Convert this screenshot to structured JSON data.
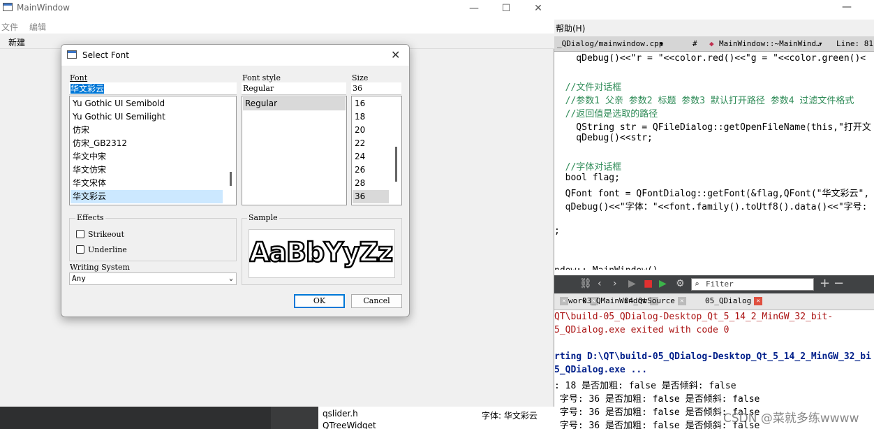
{
  "ide": {
    "minimize": "—",
    "menu_help": "帮助(H)",
    "tabbar": {
      "file": "_QDialog/mainwindow.cpp",
      "hash": "#",
      "symbol": "MainWindow::~MainWind…",
      "line": "Line: 81,"
    },
    "editor_lines": [
      {
        "text": "    qDebug()<<\"r = \"<<color.red()<<\"g = \"<<color.green()<",
        "cls": ""
      },
      {
        "text": "",
        "cls": ""
      },
      {
        "text": "  //文件对话框",
        "cls": "c-cmt"
      },
      {
        "text": "  //参数1 父亲 参数2 标题 参数3 默认打开路径 参数4 过滤文件格式",
        "cls": "c-cmt"
      },
      {
        "text": "  //返回值是选取的路径",
        "cls": "c-cmt"
      },
      {
        "text": "    QString str = QFileDialog::getOpenFileName(this,\"打开文",
        "cls": ""
      },
      {
        "text": "    qDebug()<<str;",
        "cls": ""
      },
      {
        "text": "",
        "cls": ""
      },
      {
        "text": "  //字体对话框",
        "cls": "c-cmt"
      },
      {
        "text": "  bool flag;",
        "cls": ""
      },
      {
        "text": "  QFont font = QFontDialog::getFont(&flag,QFont(\"华文彩云\",",
        "cls": ""
      },
      {
        "text": "  qDebug()<<\"字体：\"<<font.family().toUtf8().data()<<\"字号:",
        "cls": ""
      },
      {
        "text": "",
        "cls": ""
      },
      {
        "text": ";",
        "cls": ""
      },
      {
        "text": "",
        "cls": ""
      },
      {
        "text": "",
        "cls": ""
      },
      {
        "text": "ndow::~MainWindow()",
        "cls": ""
      }
    ],
    "filter_placeholder": "Filter",
    "output_tabs": [
      {
        "label": "work",
        "active": false
      },
      {
        "label": "03_QMainWindow",
        "active": false
      },
      {
        "label": "04_QtSource",
        "active": false
      },
      {
        "label": "05_QDialog",
        "active": true
      }
    ],
    "output_lines": [
      {
        "text": "QT\\build-05_QDialog-Desktop_Qt_5_14_2_MinGW_32_bit-",
        "cls": "red"
      },
      {
        "text": "5_QDialog.exe exited with code 0",
        "cls": "red"
      },
      {
        "text": "",
        "cls": ""
      },
      {
        "text": "rting D:\\QT\\build-05_QDialog-Desktop_Qt_5_14_2_MinGW_32_bi",
        "cls": "blue"
      },
      {
        "text": "5_QDialog.exe ...",
        "cls": "blue"
      },
      {
        "text": ": 18 是否加粗: false 是否倾斜: false",
        "cls": ""
      },
      {
        "text": " 字号: 36 是否加粗: false 是否倾斜: false",
        "cls": ""
      },
      {
        "text": " 字号: 36 是否加粗: false 是否倾斜: false",
        "cls": ""
      },
      {
        "text": " 字号: 36 是否加粗: false 是否倾斜: false",
        "cls": ""
      }
    ],
    "bottom_left_file": "qslider.h",
    "bottom_left_file2": "QTreeWidget",
    "bottom_output_prefix": "字体:  华文彩云",
    "watermark": "CSDN @菜就多练wwww"
  },
  "mainwindow": {
    "title": "MainWindow",
    "menu": [
      "文件",
      "编辑"
    ],
    "toolbar_action": "新建",
    "controls": {
      "minimize": "—",
      "maximize": "☐",
      "close": "✕"
    }
  },
  "dialog": {
    "title": "Select Font",
    "close": "✕",
    "font_label": "Font",
    "font_style_label": "Font style",
    "size_label": "Size",
    "font_value": "华文彩云",
    "style_value": "Regular",
    "size_value": "36",
    "fonts": [
      "Yu Gothic UI Semibold",
      "Yu Gothic UI Semilight",
      "仿宋",
      "仿宋_GB2312",
      "华文中宋",
      "华文仿宋",
      "华文宋体",
      "华文彩云"
    ],
    "selected_font_index": 7,
    "styles": [
      "Regular"
    ],
    "sizes": [
      "16",
      "18",
      "20",
      "22",
      "24",
      "26",
      "28",
      "36"
    ],
    "selected_size_index": 7,
    "effects_label": "Effects",
    "strikeout_label": "Strikeout",
    "underline_label": "Underline",
    "strikeout_checked": false,
    "underline_checked": false,
    "writing_system_label": "Writing System",
    "writing_system_value": "Any",
    "sample_label": "Sample",
    "sample_text": "AaBbYyZz",
    "ok_label": "OK",
    "cancel_label": "Cancel"
  }
}
